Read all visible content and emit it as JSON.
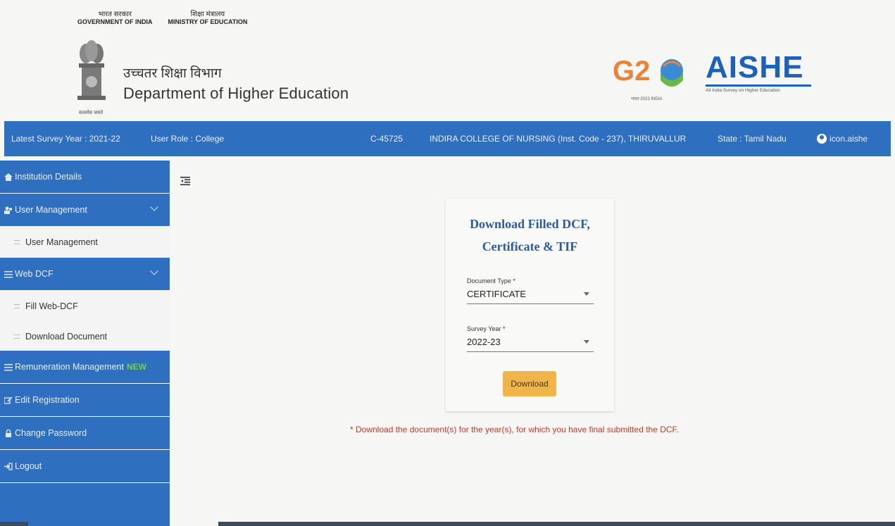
{
  "header": {
    "gov_hi": "भारत सरकार",
    "gov_en": "GOVERNMENT OF INDIA",
    "ministry_hi": "शिक्षा मंत्रालय",
    "ministry_en": "MINISTRY OF EDUCATION",
    "emblem_caption": "सत्यमेव जयते",
    "dept_hi": "उच्चतर शिक्षा विभाग",
    "dept_en": "Department of Higher Education",
    "g20_text": "G20",
    "aishe_logo": "AISHE",
    "aishe_sub": "All India Survey on Higher Education"
  },
  "topbar": {
    "survey_year": "Latest Survey Year : 2021-22",
    "user_role": "User Role : College",
    "code": "C-45725",
    "institution": "INDIRA COLLEGE OF NURSING (Inst. Code - 237), THIRUVALLUR",
    "state": "State : Tamil Nadu",
    "username": "icon.aishe"
  },
  "sidebar": {
    "institution_details": "Institution Details",
    "user_management": "User Management",
    "user_management_sub": "User Management",
    "web_dcf": "Web DCF",
    "fill_web_dcf": "Fill Web-DCF",
    "download_document": "Download Document",
    "remuneration": "Remuneration Management",
    "new_badge": "NEW",
    "edit_registration": "Edit Registration",
    "change_password": "Change Password",
    "logout": "Logout"
  },
  "card": {
    "title_line1": "Download Filled DCF,",
    "title_line2": "Certificate & TIF",
    "doc_type_label": "Document Type *",
    "doc_type_value": "CERTIFICATE",
    "survey_year_label": "Survey Year *",
    "survey_year_value": "2022-23",
    "download_label": "Download"
  },
  "note": "* Download the document(s) for the year(s), for which you have final submitted the DCF.",
  "colors": {
    "primary_blue": "#2f6fc0",
    "button_amber": "#f0b54a",
    "note_red": "#c0382b",
    "title_blue": "#2d5aa0"
  }
}
